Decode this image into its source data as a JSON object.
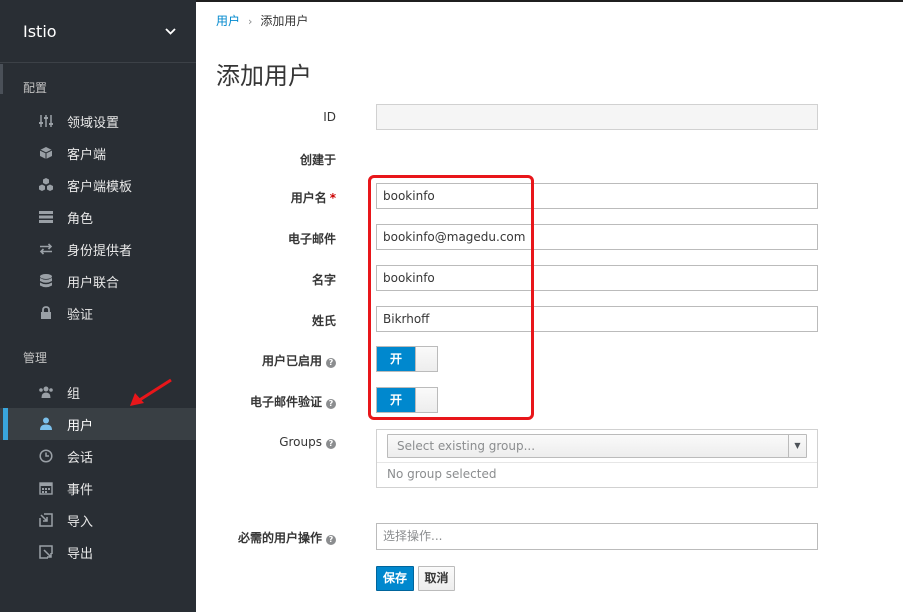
{
  "sidebar": {
    "realm_name": "Istio",
    "section_config": "配置",
    "config_items": [
      {
        "label": "领域设置",
        "icon": "sliders-icon"
      },
      {
        "label": "客户端",
        "icon": "cube-icon"
      },
      {
        "label": "客户端模板",
        "icon": "cubes-icon"
      },
      {
        "label": "角色",
        "icon": "list-icon"
      },
      {
        "label": "身份提供者",
        "icon": "exchange-icon"
      },
      {
        "label": "用户联合",
        "icon": "database-icon"
      },
      {
        "label": "验证",
        "icon": "lock-icon"
      }
    ],
    "section_manage": "管理",
    "manage_items": [
      {
        "label": "组",
        "icon": "users-icon"
      },
      {
        "label": "用户",
        "icon": "user-icon"
      },
      {
        "label": "会话",
        "icon": "clock-icon"
      },
      {
        "label": "事件",
        "icon": "calendar-icon"
      },
      {
        "label": "导入",
        "icon": "import-icon"
      },
      {
        "label": "导出",
        "icon": "export-icon"
      }
    ],
    "active_item": "用户"
  },
  "breadcrumb": {
    "parent": "用户",
    "current": "添加用户"
  },
  "page_title": "添加用户",
  "form": {
    "id_label": "ID",
    "id_value": "",
    "created_label": "创建于",
    "username_label": "用户名",
    "username_required": "*",
    "username_value": "bookinfo",
    "email_label": "电子邮件",
    "email_value": "bookinfo@magedu.com",
    "firstname_label": "名字",
    "firstname_value": "bookinfo",
    "lastname_label": "姓氏",
    "lastname_value": "Bikrhoff",
    "enabled_label": "用户已启用",
    "enabled_value": "开",
    "email_verified_label": "电子邮件验证",
    "email_verified_value": "开",
    "groups_label": "Groups",
    "groups_placeholder": "Select existing group...",
    "groups_empty": "No group selected",
    "required_actions_label": "必需的用户操作",
    "required_actions_placeholder": "选择操作..."
  },
  "buttons": {
    "save": "保存",
    "cancel": "取消"
  },
  "colors": {
    "accent": "#0088ce",
    "sidebar_bg": "#292e34",
    "annotation": "#e8161a"
  }
}
